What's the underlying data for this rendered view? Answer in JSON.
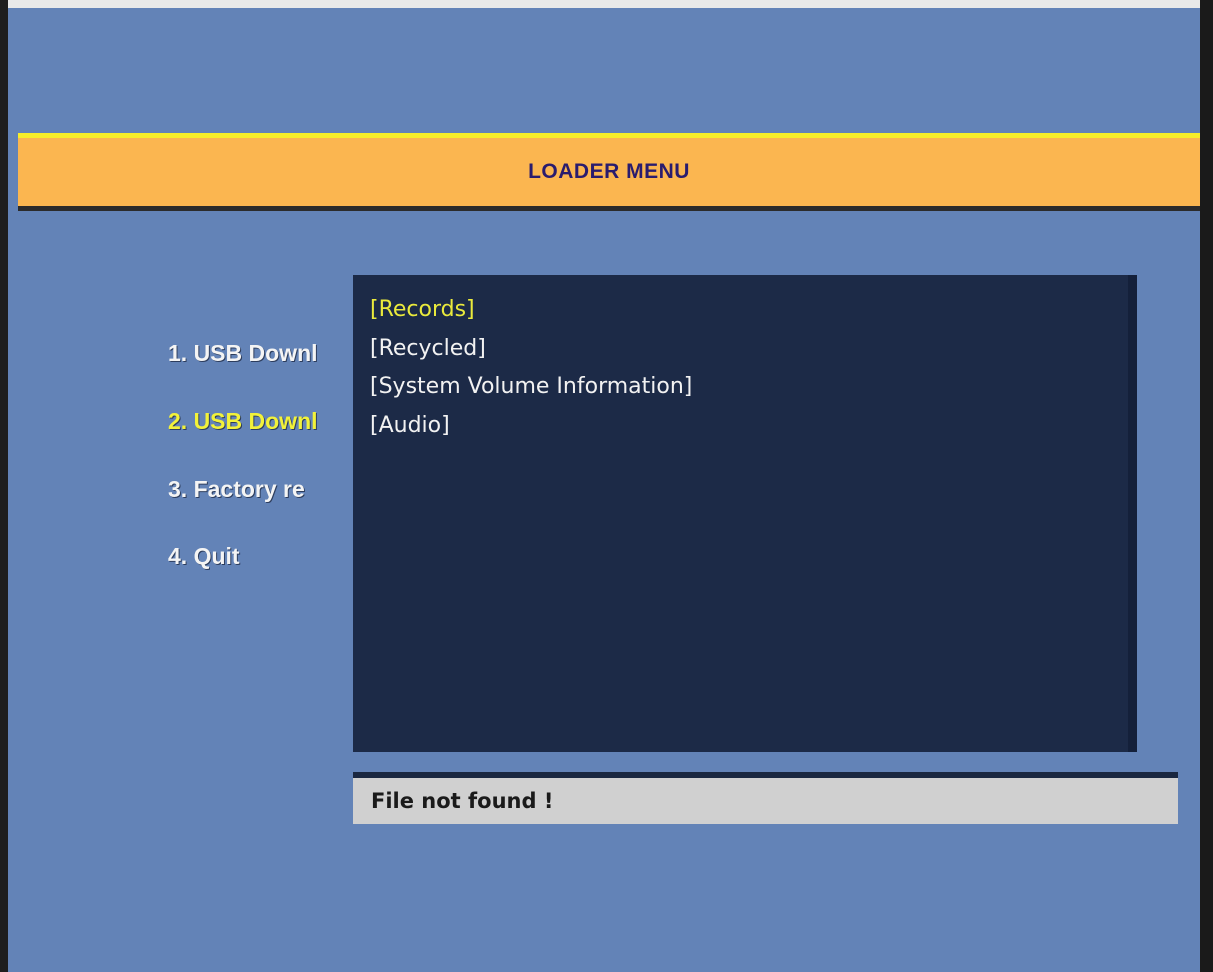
{
  "header": {
    "title": "LOADER MENU"
  },
  "menu": {
    "items": [
      {
        "label": "1. USB Downl",
        "selected": false
      },
      {
        "label": "2. USB Downl",
        "selected": true
      },
      {
        "label": "3. Factory re",
        "selected": false
      },
      {
        "label": "4. Quit",
        "selected": false
      }
    ]
  },
  "file_browser": {
    "items": [
      {
        "label": "[Records]",
        "selected": true
      },
      {
        "label": "[Recycled]",
        "selected": false
      },
      {
        "label": "[System Volume Information]",
        "selected": false
      },
      {
        "label": "[Audio]",
        "selected": false
      }
    ]
  },
  "status": {
    "message": "File not found !"
  },
  "colors": {
    "background": "#6383b7",
    "header_band": "#fbb650",
    "header_text": "#2a1c6e",
    "selected_text": "#f2f23a",
    "panel": "#1c2a47",
    "status_bar": "#d0d0d0"
  }
}
